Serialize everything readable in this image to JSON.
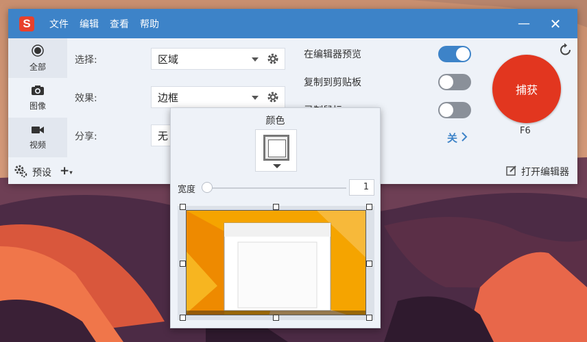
{
  "app": {
    "logo_letter": "S",
    "menu": [
      "文件",
      "编辑",
      "查看",
      "帮助"
    ],
    "minimize": "—",
    "close": "✕"
  },
  "sidebar": {
    "items": [
      {
        "label": "全部",
        "icon": "target-icon",
        "active": false
      },
      {
        "label": "图像",
        "icon": "camera-icon",
        "active": true
      },
      {
        "label": "视频",
        "icon": "video-camera-icon",
        "active": false
      }
    ]
  },
  "settings": {
    "select_label": "选择:",
    "select_value": "区域",
    "effect_label": "效果:",
    "effect_value": "边框",
    "share_label": "分享:",
    "share_value": "无"
  },
  "options": {
    "preview_in_editor": "在编辑器预览",
    "preview_in_editor_on": true,
    "copy_to_clipboard": "复制到剪贴板",
    "copy_to_clipboard_on": false,
    "record_mouse": "录制鼠标",
    "record_mouse_on": false,
    "off_link": "关"
  },
  "capture": {
    "label": "捕获",
    "hotkey": "F6"
  },
  "bottom": {
    "presets": "预设",
    "add": "+",
    "open_editor": "打开编辑器"
  },
  "border_popup": {
    "title": "颜色",
    "width_label": "宽度",
    "width_value": "1",
    "width_fraction": 0.0
  },
  "colors": {
    "titlebar": "#3d83c8",
    "capture": "#e2361f",
    "toggle_on": "#3d83c8",
    "toggle_off": "#8a9099"
  }
}
